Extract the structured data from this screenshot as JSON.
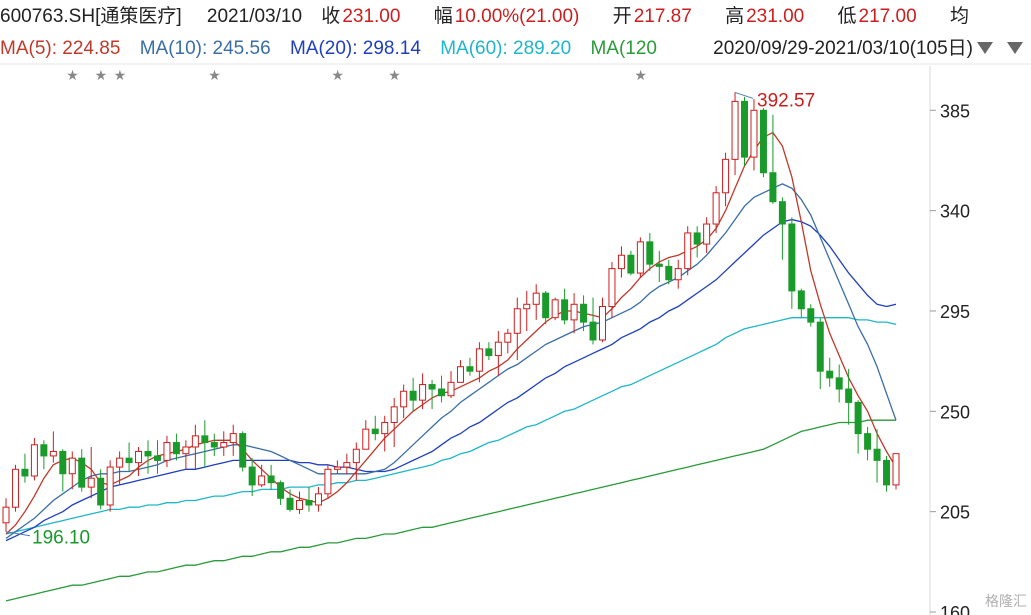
{
  "header": {
    "code": "600763.SH[通策医疗]",
    "date": "2021/03/10",
    "close_label": "收",
    "close": "231.00",
    "change_label": "幅",
    "change": "10.00%(21.00)",
    "open_label": "开",
    "open": "217.87",
    "high_label": "高",
    "high": "231.00",
    "low_label": "低",
    "low": "217.00",
    "avg_label": "均"
  },
  "ma_bar": {
    "ma5": "MA(5): 224.85",
    "ma10": "MA(10): 245.56",
    "ma20": "MA(20): 298.14",
    "ma60": "MA(60): 289.20",
    "ma120": "MA(120",
    "range": "2020/09/29-2021/03/10(105日)"
  },
  "colors": {
    "up": "#cc1e1e",
    "down": "#1a9a2a",
    "ma5": "#c0392b",
    "ma10": "#3a6ea5",
    "ma20": "#1f3fbf",
    "ma60": "#1fb6c9",
    "ma120": "#2a9a3a"
  },
  "chart_data": {
    "type": "candlestick",
    "y_ticks": [
      "385",
      "340",
      "295",
      "250",
      "205",
      "160"
    ],
    "ylim": [
      160,
      395
    ],
    "annotations": {
      "high": "392.57",
      "low": "196.10"
    },
    "candles": [
      [
        200,
        196,
        211,
        207
      ],
      [
        207,
        205,
        226,
        224
      ],
      [
        224,
        218,
        231,
        221
      ],
      [
        221,
        219,
        238,
        235
      ],
      [
        235,
        224,
        237,
        230
      ],
      [
        230,
        227,
        241,
        232
      ],
      [
        232,
        214,
        233,
        222
      ],
      [
        222,
        215,
        232,
        229
      ],
      [
        229,
        214,
        233,
        216
      ],
      [
        216,
        211,
        234,
        220
      ],
      [
        220,
        206,
        224,
        208
      ],
      [
        208,
        205,
        228,
        225
      ],
      [
        225,
        217,
        232,
        229
      ],
      [
        229,
        223,
        236,
        227
      ],
      [
        227,
        221,
        234,
        232
      ],
      [
        232,
        222,
        237,
        230
      ],
      [
        230,
        222,
        237,
        228
      ],
      [
        228,
        225,
        239,
        236
      ],
      [
        236,
        228,
        240,
        231
      ],
      [
        231,
        224,
        237,
        234
      ],
      [
        234,
        224,
        244,
        239
      ],
      [
        239,
        225,
        246,
        236
      ],
      [
        236,
        230,
        240,
        234
      ],
      [
        234,
        230,
        241,
        236
      ],
      [
        236,
        230,
        244,
        240
      ],
      [
        240,
        223,
        241,
        225
      ],
      [
        225,
        212,
        229,
        217
      ],
      [
        217,
        216,
        226,
        221
      ],
      [
        221,
        215,
        226,
        218
      ],
      [
        218,
        208,
        219,
        211
      ],
      [
        211,
        205,
        215,
        206
      ],
      [
        206,
        204,
        214,
        210
      ],
      [
        210,
        205,
        216,
        208
      ],
      [
        208,
        205,
        216,
        213
      ],
      [
        213,
        211,
        226,
        224
      ],
      [
        224,
        222,
        228,
        225
      ],
      [
        225,
        222,
        231,
        227
      ],
      [
        227,
        219,
        236,
        233
      ],
      [
        233,
        233,
        246,
        242
      ],
      [
        242,
        237,
        248,
        240
      ],
      [
        240,
        232,
        248,
        245
      ],
      [
        245,
        234,
        256,
        252
      ],
      [
        252,
        247,
        262,
        259
      ],
      [
        259,
        250,
        265,
        255
      ],
      [
        255,
        251,
        267,
        262
      ],
      [
        262,
        251,
        264,
        260
      ],
      [
        260,
        254,
        266,
        257
      ],
      [
        257,
        256,
        268,
        263
      ],
      [
        263,
        263,
        273,
        270
      ],
      [
        270,
        266,
        274,
        268
      ],
      [
        268,
        263,
        281,
        278
      ],
      [
        278,
        273,
        281,
        275
      ],
      [
        275,
        266,
        286,
        281
      ],
      [
        281,
        276,
        287,
        285
      ],
      [
        285,
        273,
        301,
        296
      ],
      [
        296,
        286,
        304,
        298
      ],
      [
        298,
        291,
        307,
        303
      ],
      [
        303,
        289,
        304,
        292
      ],
      [
        292,
        291,
        301,
        300
      ],
      [
        300,
        289,
        305,
        291
      ],
      [
        291,
        285,
        303,
        298
      ],
      [
        298,
        286,
        302,
        290
      ],
      [
        290,
        280,
        301,
        282
      ],
      [
        282,
        281,
        301,
        297
      ],
      [
        297,
        292,
        317,
        314
      ],
      [
        314,
        310,
        324,
        320
      ],
      [
        320,
        311,
        322,
        312
      ],
      [
        312,
        310,
        328,
        326
      ],
      [
        326,
        313,
        330,
        316
      ],
      [
        316,
        308,
        322,
        315
      ],
      [
        315,
        307,
        318,
        309
      ],
      [
        309,
        305,
        318,
        314
      ],
      [
        314,
        311,
        333,
        330
      ],
      [
        330,
        319,
        333,
        325
      ],
      [
        325,
        321,
        337,
        334
      ],
      [
        334,
        330,
        351,
        348
      ],
      [
        348,
        342,
        366,
        363
      ],
      [
        363,
        356,
        393,
        389
      ],
      [
        389,
        360,
        391,
        364
      ],
      [
        364,
        358,
        390,
        385
      ],
      [
        385,
        355,
        386,
        357
      ],
      [
        357,
        343,
        383,
        344
      ],
      [
        344,
        318,
        346,
        334
      ],
      [
        334,
        296,
        337,
        304
      ],
      [
        304,
        292,
        305,
        296
      ],
      [
        296,
        288,
        298,
        290
      ],
      [
        290,
        260,
        292,
        268
      ],
      [
        268,
        261,
        274,
        265
      ],
      [
        265,
        254,
        271,
        260
      ],
      [
        260,
        244,
        269,
        254
      ],
      [
        254,
        231,
        255,
        240
      ],
      [
        240,
        228,
        243,
        233
      ],
      [
        233,
        218,
        242,
        228
      ],
      [
        228,
        214,
        230,
        217
      ],
      [
        217,
        215,
        231,
        231
      ]
    ],
    "ma5": [
      195,
      199,
      205,
      212,
      220,
      226,
      228,
      229,
      227,
      224,
      218,
      217,
      219,
      221,
      225,
      228,
      230,
      231,
      232,
      233,
      235,
      236,
      237,
      237,
      237,
      233,
      228,
      224,
      220,
      216,
      213,
      211,
      210,
      209,
      211,
      214,
      218,
      223,
      228,
      233,
      238,
      242,
      246,
      250,
      253,
      256,
      258,
      259,
      261,
      263,
      265,
      268,
      270,
      273,
      278,
      282,
      286,
      290,
      293,
      295,
      295,
      294,
      293,
      292,
      296,
      301,
      305,
      310,
      314,
      317,
      319,
      320,
      322,
      324,
      327,
      332,
      340,
      350,
      360,
      367,
      373,
      375,
      369,
      355,
      335,
      313,
      298,
      285,
      275,
      265,
      257,
      250,
      240,
      232,
      225
    ],
    "ma10": [
      193,
      196,
      199,
      202,
      206,
      210,
      213,
      216,
      219,
      221,
      222,
      222,
      223,
      223,
      224,
      225,
      226,
      228,
      229,
      230,
      231,
      232,
      233,
      234,
      235,
      235,
      234,
      233,
      232,
      230,
      228,
      226,
      224,
      222,
      222,
      222,
      222,
      222,
      222,
      223,
      224,
      227,
      231,
      235,
      239,
      243,
      247,
      250,
      254,
      257,
      260,
      263,
      266,
      269,
      271,
      274,
      277,
      280,
      282,
      284,
      286,
      288,
      289,
      290,
      292,
      294,
      296,
      299,
      303,
      306,
      308,
      310,
      313,
      316,
      320,
      325,
      330,
      336,
      342,
      346,
      348,
      350,
      352,
      350,
      345,
      338,
      328,
      318,
      308,
      298,
      288,
      280,
      270,
      258,
      246
    ],
    "ma20": [
      192,
      194,
      196,
      198,
      201,
      203,
      205,
      208,
      210,
      212,
      214,
      216,
      217,
      218,
      219,
      220,
      221,
      222,
      223,
      224,
      224,
      225,
      226,
      227,
      228,
      228,
      228,
      228,
      228,
      228,
      228,
      227,
      227,
      226,
      226,
      225,
      225,
      224,
      223,
      223,
      223,
      224,
      226,
      228,
      230,
      232,
      235,
      238,
      240,
      243,
      245,
      248,
      251,
      254,
      256,
      259,
      262,
      265,
      267,
      270,
      272,
      274,
      276,
      278,
      280,
      283,
      285,
      287,
      290,
      292,
      295,
      297,
      300,
      303,
      306,
      309,
      313,
      317,
      321,
      325,
      329,
      332,
      335,
      336,
      335,
      333,
      329,
      324,
      318,
      312,
      307,
      302,
      298,
      297,
      298
    ],
    "ma60": [
      195,
      196,
      197,
      198,
      199,
      200,
      201,
      202,
      203,
      204,
      205,
      206,
      206,
      207,
      207,
      208,
      208,
      209,
      209,
      210,
      210,
      211,
      212,
      212,
      213,
      214,
      214,
      215,
      215,
      215,
      216,
      216,
      216,
      217,
      217,
      218,
      218,
      219,
      219,
      220,
      221,
      222,
      223,
      224,
      225,
      226,
      228,
      229,
      231,
      232,
      234,
      236,
      237,
      239,
      241,
      243,
      244,
      246,
      248,
      250,
      251,
      253,
      255,
      257,
      259,
      261,
      262,
      264,
      266,
      268,
      270,
      272,
      274,
      276,
      278,
      280,
      283,
      285,
      287,
      288,
      289,
      290,
      291,
      292,
      292,
      292,
      292,
      292,
      292,
      292,
      291,
      291,
      290,
      290,
      289
    ],
    "ma120": [
      165,
      166,
      167,
      168,
      169,
      170,
      171,
      172,
      172,
      173,
      174,
      175,
      176,
      176,
      177,
      178,
      178,
      179,
      180,
      181,
      181,
      182,
      183,
      183,
      184,
      185,
      185,
      186,
      187,
      187,
      188,
      189,
      189,
      190,
      191,
      191,
      192,
      193,
      193,
      194,
      195,
      195,
      196,
      197,
      198,
      198,
      199,
      200,
      201,
      202,
      203,
      204,
      205,
      206,
      207,
      208,
      209,
      210,
      211,
      212,
      213,
      214,
      215,
      216,
      217,
      218,
      219,
      220,
      221,
      222,
      223,
      224,
      225,
      226,
      227,
      228,
      229,
      230,
      231,
      232,
      233,
      235,
      237,
      239,
      241,
      242,
      243,
      244,
      245,
      245,
      245,
      246,
      246,
      246,
      246
    ],
    "star_indices": [
      7,
      10,
      12,
      22,
      35,
      41,
      67
    ]
  },
  "watermark": "格隆汇"
}
